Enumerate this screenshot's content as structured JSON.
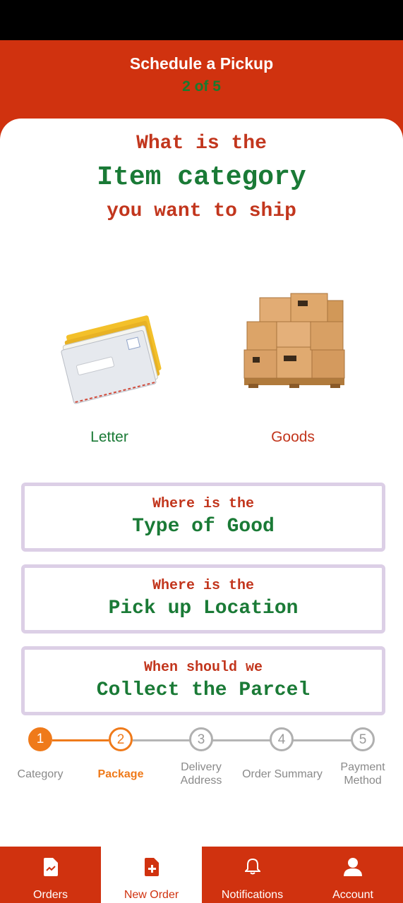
{
  "header": {
    "title": "Schedule a Pickup",
    "step": "2 of 5"
  },
  "question": {
    "line1": "What is the",
    "line2": "Item category",
    "line3": "you want to ship"
  },
  "options": [
    {
      "label": "Letter",
      "color": "#1a7a36",
      "icon": "letter-envelopes-image"
    },
    {
      "label": "Goods",
      "color": "#c2361d",
      "icon": "goods-boxes-image"
    }
  ],
  "boxes": [
    {
      "line1": "Where is the",
      "line2": "Type of Good"
    },
    {
      "line1": "Where is the",
      "line2": "Pick up Location"
    },
    {
      "line1": "When should we",
      "line2": "Collect the Parcel"
    }
  ],
  "stepper": [
    {
      "num": "1",
      "label": "Category",
      "state": "done"
    },
    {
      "num": "2",
      "label": "Package",
      "state": "active"
    },
    {
      "num": "3",
      "label": "Delivery Address",
      "state": "pending"
    },
    {
      "num": "4",
      "label": "Order Summary",
      "state": "pending"
    },
    {
      "num": "5",
      "label": "Payment Method",
      "state": "pending"
    }
  ],
  "nav": [
    {
      "label": "Orders",
      "icon": "document-icon",
      "active": false
    },
    {
      "label": "New Order",
      "icon": "add-document-icon",
      "active": true
    },
    {
      "label": "Notifications",
      "icon": "bell-icon",
      "active": false
    },
    {
      "label": "Account",
      "icon": "user-icon",
      "active": false
    }
  ],
  "colors": {
    "brand": "#d0320f",
    "accent_orange": "#ef7a1a",
    "green": "#1a7a36",
    "red_text": "#c2361d"
  }
}
